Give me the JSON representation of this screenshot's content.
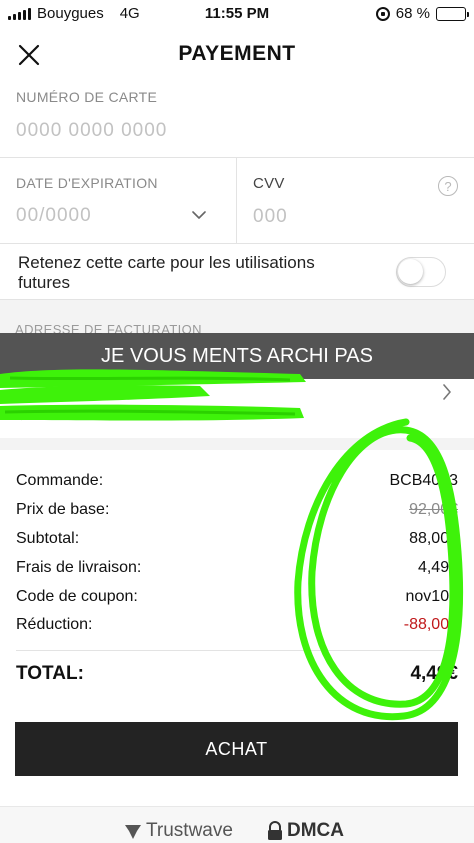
{
  "status_bar": {
    "carrier": "Bouygues",
    "network": "4G",
    "time": "11:55 PM",
    "battery": "68 %",
    "battery_level": 0.68
  },
  "header": {
    "title": "PAYEMENT",
    "close_icon": "close-icon"
  },
  "card": {
    "number_label": "NUMÉRO DE CARTE",
    "number_placeholder": "0000 0000 0000",
    "expiry_label": "DATE D'EXPIRATION",
    "expiry_placeholder": "00/0000",
    "cvv_label": "CVV",
    "cvv_placeholder": "000",
    "cvv_help_icon": "?"
  },
  "remember": {
    "label": "Retenez cette carte pour les utilisations futures",
    "enabled": false
  },
  "billing": {
    "label": "ADRESSE DE FACTURATION",
    "line2_visible": "320"
  },
  "overlay": {
    "banner_text": "JE VOUS MENTS ARCHI PAS",
    "scribble_color": "#3ef20a"
  },
  "summary": {
    "rows": [
      {
        "label": "Commande:",
        "value": "BCB4063"
      },
      {
        "label": "Prix de base:",
        "value": "92,00€"
      },
      {
        "label": "Subtotal:",
        "value": "88,00€"
      },
      {
        "label": "Frais de livraison:",
        "value": "4,49€"
      },
      {
        "label": "Code de coupon:",
        "value": "nov100"
      },
      {
        "label": "Réduction:",
        "value": "-88,00€"
      }
    ],
    "total_label": "TOTAL:",
    "total_value": "4,49€"
  },
  "cta": {
    "label": "ACHAT"
  },
  "footer": {
    "trustwave": "Trustwave",
    "dmca": "DMCA"
  },
  "colors": {
    "accent_dark": "#232323",
    "discount_red": "#c0191b",
    "scribble_green": "#3ef20a"
  }
}
